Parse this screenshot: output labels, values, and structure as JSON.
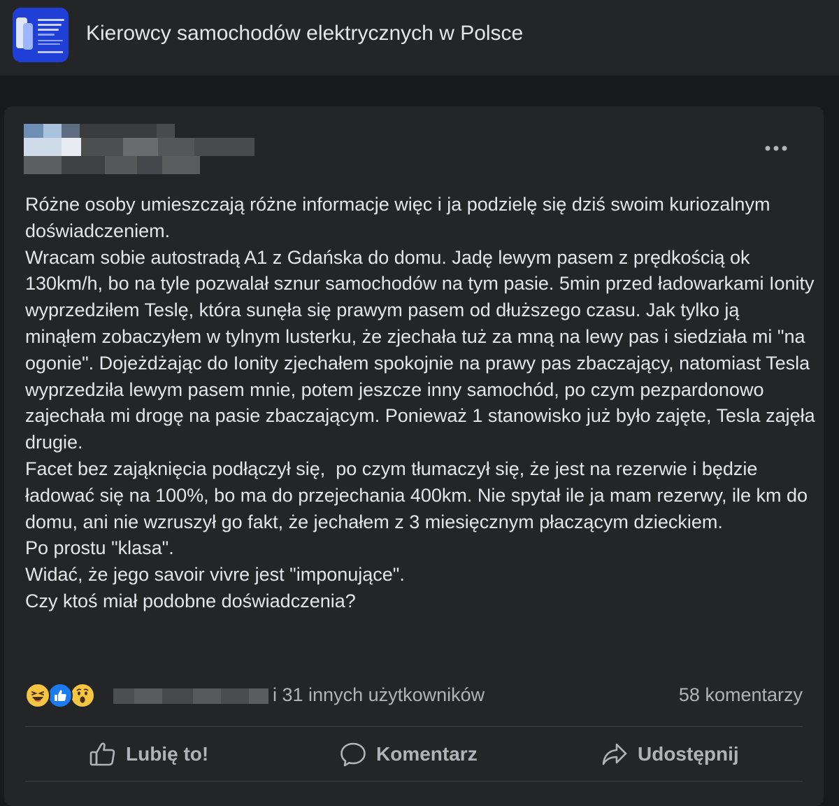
{
  "group": {
    "title": "Kierowcy samochodów elektrycznych w Polsce",
    "thumbnail_color": "#1f3fd6"
  },
  "post": {
    "author_name_visible": false,
    "more_icon": "more-horizontal-icon",
    "paragraphs": [
      "Różne osoby umieszczają różne informacje więc i ja podzielę się dziś swoim kuriozalnym doświadczeniem.",
      "Wracam sobie autostradą A1 z Gdańska do domu. Jadę lewym pasem z prędkością ok 130km/h, bo na tyle pozwalał sznur samochodów na tym pasie. 5min przed ładowarkami Ionity wyprzedziłem Teslę, która sunęła się prawym pasem od dłuższego czasu. Jak tylko ją minąłem zobaczyłem w tylnym lusterku, że zjechała tuż za mną na lewy pas i siedziała mi \"na ogonie\". Dojeżdżając do Ionity zjechałem spokojnie na prawy pas zbaczający, natomiast Tesla wyprzedziła lewym pasem mnie, potem jeszcze inny samochód, po czym pezpardonowo zajechała mi drogę na pasie zbaczającym. Ponieważ 1 stanowisko już było zajęte, Tesla zajęła drugie.",
      "Facet bez zająknięcia podłączył się,  po czym tłumaczył się, że jest na rezerwie i będzie ładować się na 100%, bo ma do przejechania 400km. Nie spytał ile ja mam rezerwy, ile km do domu, ani nie wzruszył go fakt, że jechałem z 3 miesięcznym płaczącym dzieckiem.",
      "Po prostu \"klasa\".",
      "Widać, że jego savoir vivre jest \"imponujące\".",
      "Czy ktoś miał podobne doświadczenia?"
    ]
  },
  "reactions": {
    "icons": [
      "haha-reaction-icon",
      "like-reaction-icon",
      "wow-reaction-icon"
    ],
    "others_text": "i 31 innych użytkowników",
    "comments_text": "58 komentarzy"
  },
  "actions": {
    "like": "Lubię to!",
    "comment": "Komentarz",
    "share": "Udostępnij"
  },
  "colors": {
    "background": "#18191a",
    "card": "#242526",
    "text": "#e4e6eb",
    "secondary_text": "#b0b3b8",
    "like_blue": "#1d7bf0",
    "reaction_yellow": "#f6c643"
  }
}
